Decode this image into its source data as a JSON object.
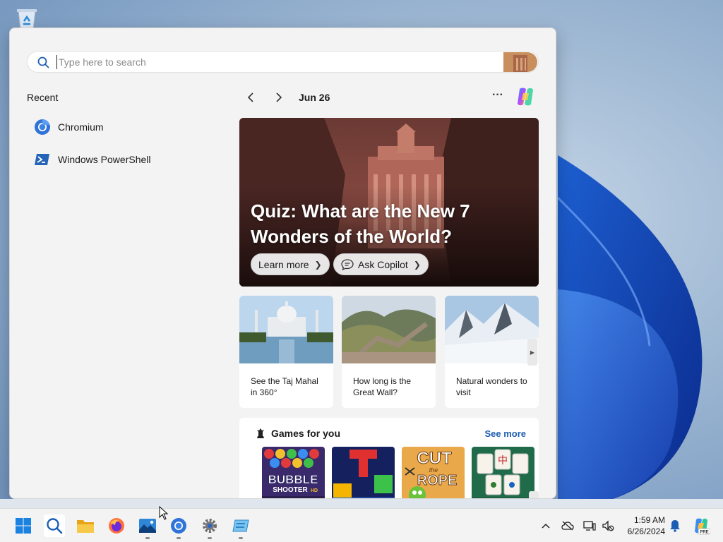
{
  "desktop": {
    "recycle_bin_icon": "recycle-bin-icon"
  },
  "search": {
    "placeholder": "Type here to search",
    "value": ""
  },
  "recent": {
    "title": "Recent",
    "items": [
      {
        "label": "Chromium",
        "icon": "chromium-icon"
      },
      {
        "label": "Windows PowerShell",
        "icon": "powershell-icon"
      }
    ]
  },
  "feed": {
    "date": "Jun 26",
    "more_label": "···",
    "hero": {
      "title": "Quiz: What are the New 7 Wonders of the World?",
      "learn_more": "Learn more",
      "ask_copilot": "Ask Copilot"
    },
    "cards": [
      {
        "text": "See the Taj Mahal in 360°"
      },
      {
        "text": "How long is the Great Wall?"
      },
      {
        "text": "Natural wonders to visit"
      }
    ],
    "games": {
      "title": "Games for you",
      "see_more": "See more",
      "tiles": [
        "Bubble Shooter HD",
        "Block puzzle",
        "Cut the Rope",
        "Mahjong"
      ],
      "tile_texts": {
        "bubble": "BUBBLE",
        "shooter": "SHOOTER",
        "hd": "HD",
        "cut": "CUT",
        "the": "the",
        "rope": "ROPE",
        "mahjong_glyph": "中"
      }
    }
  },
  "taskbar": {
    "apps": [
      "start-icon",
      "search-icon",
      "file-explorer-icon",
      "firefox-icon",
      "photos-icon",
      "chromium-icon",
      "settings-icon",
      "app-icon"
    ]
  },
  "tray": {
    "time": "1:59 AM",
    "date": "6/26/2024",
    "copilot_badge": "PRE"
  },
  "colors": {
    "accent": "#1f5fb2",
    "panel": "#f3f3f3"
  }
}
